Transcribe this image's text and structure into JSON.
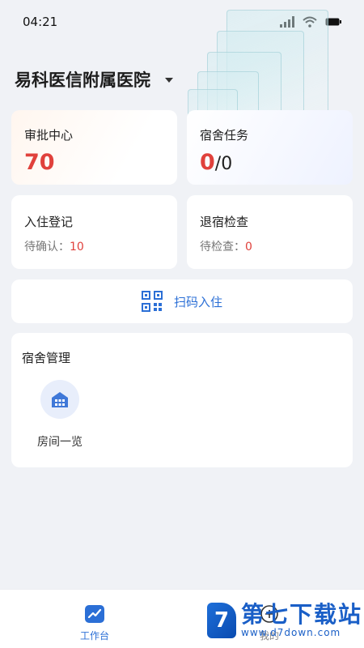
{
  "status_bar": {
    "time": "04:21"
  },
  "header": {
    "hospital_name": "易科医信附属医院"
  },
  "approval_card": {
    "title": "审批中心",
    "count": "70"
  },
  "dorm_task_card": {
    "title": "宿舍任务",
    "done": "0",
    "total": "/0"
  },
  "checkin_card": {
    "title": "入住登记",
    "pending_label": "待确认：",
    "pending_count": "10"
  },
  "checkout_card": {
    "title": "退宿检查",
    "pending_label": "待检查：",
    "pending_count": "0"
  },
  "scan_button": {
    "label": "扫码入住"
  },
  "dorm_management": {
    "title": "宿舍管理",
    "items": [
      {
        "label": "房间一览",
        "icon": "building-icon"
      }
    ]
  },
  "tabbar": {
    "tabs": [
      {
        "label": "工作台",
        "icon": "chart-icon",
        "active": true
      },
      {
        "label": "我的",
        "icon": "user-icon",
        "active": false
      }
    ]
  },
  "watermark": {
    "title": "第七下载站",
    "url": "www.d7down.com",
    "logo_letter": "7"
  },
  "colors": {
    "accent": "#2b6fd6",
    "highlight": "#e0413c",
    "background": "#f0f2f6"
  }
}
